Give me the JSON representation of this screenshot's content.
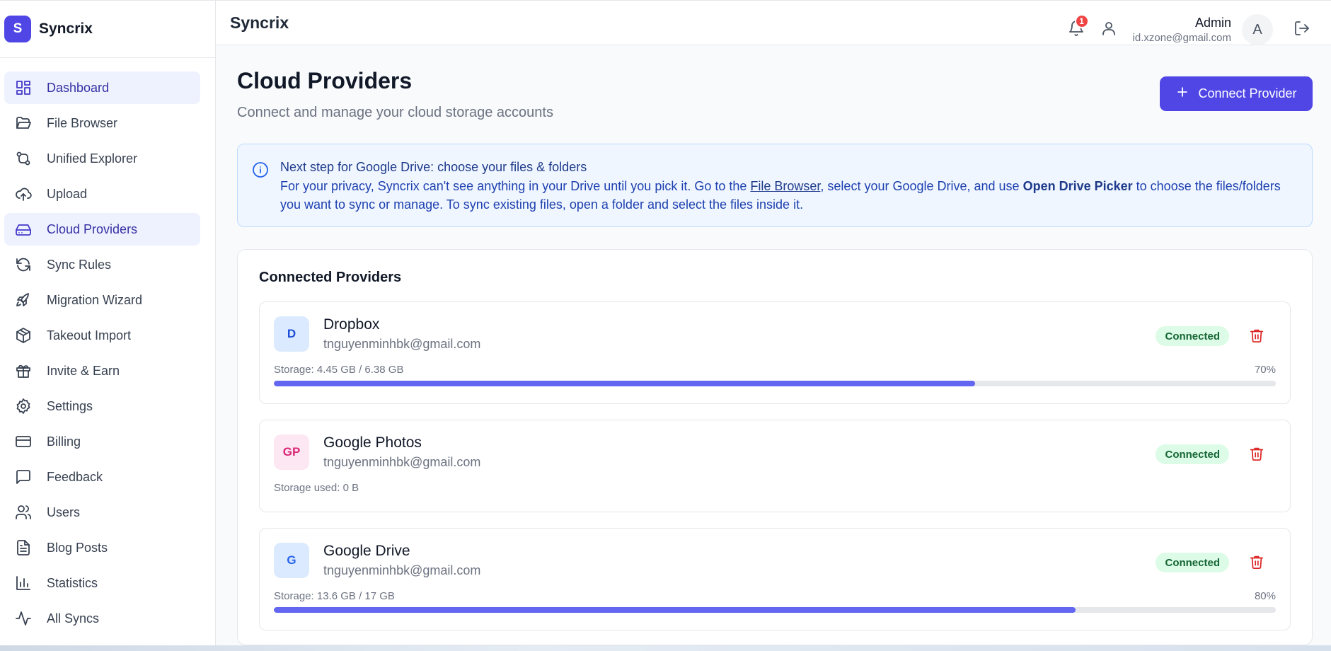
{
  "brand": {
    "logo_letter": "S",
    "name": "Syncrix"
  },
  "sidebar": {
    "items": [
      {
        "label": "Dashboard",
        "icon": "dashboard-icon",
        "active": true
      },
      {
        "label": "File Browser",
        "icon": "folder-open-icon",
        "active": false
      },
      {
        "label": "Unified Explorer",
        "icon": "git-compare-icon",
        "active": false
      },
      {
        "label": "Upload",
        "icon": "cloud-upload-icon",
        "active": false
      },
      {
        "label": "Cloud Providers",
        "icon": "hard-drive-icon",
        "active": true
      },
      {
        "label": "Sync Rules",
        "icon": "refresh-icon",
        "active": false
      },
      {
        "label": "Migration Wizard",
        "icon": "rocket-icon",
        "active": false
      },
      {
        "label": "Takeout Import",
        "icon": "package-icon",
        "active": false
      },
      {
        "label": "Invite & Earn",
        "icon": "gift-icon",
        "active": false
      },
      {
        "label": "Settings",
        "icon": "gear-icon",
        "active": false
      },
      {
        "label": "Billing",
        "icon": "credit-card-icon",
        "active": false
      },
      {
        "label": "Feedback",
        "icon": "message-square-icon",
        "active": false
      },
      {
        "label": "Users",
        "icon": "users-icon",
        "active": false
      },
      {
        "label": "Blog Posts",
        "icon": "file-text-icon",
        "active": false
      },
      {
        "label": "Statistics",
        "icon": "bar-chart-icon",
        "active": false
      },
      {
        "label": "All Syncs",
        "icon": "activity-icon",
        "active": false
      }
    ]
  },
  "header": {
    "title": "Syncrix",
    "notification_count": "1",
    "user_name": "Admin",
    "user_email": "id.xzone@gmail.com",
    "avatar_letter": "A"
  },
  "page": {
    "title": "Cloud Providers",
    "subtitle": "Connect and manage your cloud storage accounts",
    "connect_button": "Connect Provider"
  },
  "info": {
    "title": "Next step for Google Drive: choose your files & folders",
    "text_1": "For your privacy, Syncrix can't see anything in your Drive until you pick it. Go to the ",
    "link": "File Browser",
    "text_2": ", select your Google Drive, and use ",
    "bold": "Open Drive Picker",
    "text_3": " to choose the files/folders you want to sync or manage. To sync existing files, open a folder and select the files inside it."
  },
  "connected": {
    "title": "Connected Providers",
    "providers": [
      {
        "initials": "D",
        "name": "Dropbox",
        "email": "tnguyenminhbk@gmail.com",
        "status": "Connected",
        "storage_label": "Storage: 4.45 GB / 6.38 GB",
        "percent_label": "70%",
        "usage_fraction": 0.7,
        "icon_bg": "#dbeafe",
        "icon_color": "#1d4ed8"
      },
      {
        "initials": "GP",
        "name": "Google Photos",
        "email": "tnguyenminhbk@gmail.com",
        "status": "Connected",
        "storage_label": "Storage used: 0 B",
        "icon_bg": "#fce7f3",
        "icon_color": "#db2777"
      },
      {
        "initials": "G",
        "name": "Google Drive",
        "email": "tnguyenminhbk@gmail.com",
        "status": "Connected",
        "storage_label": "Storage: 13.6 GB / 17 GB",
        "percent_label": "80%",
        "usage_fraction": 0.8,
        "icon_bg": "#dbeafe",
        "icon_color": "#2563eb"
      }
    ]
  },
  "colors": {
    "accent": "#4f46e5",
    "danger": "#dc2626",
    "success_bg": "#dcfce7",
    "success_text": "#166534"
  }
}
